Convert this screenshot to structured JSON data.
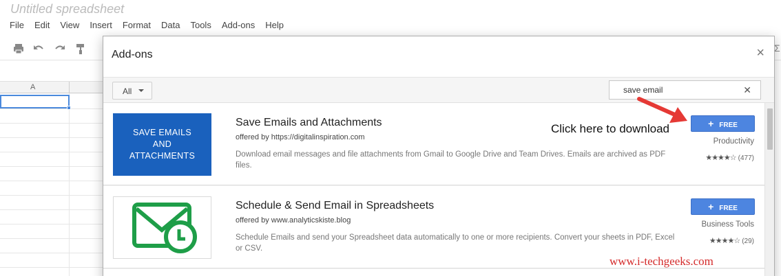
{
  "document": {
    "title": "Untitled spreadsheet"
  },
  "menu": [
    "File",
    "Edit",
    "View",
    "Insert",
    "Format",
    "Data",
    "Tools",
    "Add-ons",
    "Help"
  ],
  "sheet": {
    "column_a": "A",
    "right_edge_glyph": "Σ"
  },
  "dialog": {
    "title": "Add-ons",
    "close_glyph": "×",
    "filter": {
      "selected": "All"
    },
    "search": {
      "value": "save email",
      "clear_glyph": "✕"
    }
  },
  "addons": [
    {
      "thumb_text": [
        "SAVE EMAILS",
        "AND",
        "ATTACHMENTS"
      ],
      "name": "Save Emails and Attachments",
      "offered_by": "offered by https://digitalinspiration.com",
      "description": "Download email messages and file attachments from Gmail to Google Drive and Team Drives. Emails are archived as PDF files.",
      "button_label": "FREE",
      "category": "Productivity",
      "stars": "★★★★☆",
      "rating_count": "(477)"
    },
    {
      "name": "Schedule & Send Email in Spreadsheets",
      "offered_by": "offered by www.analyticskiste.blog",
      "description": "Schedule Emails and send your Spreadsheet data automatically to one or more recipients. Convert your sheets in PDF, Excel or CSV.",
      "button_label": "FREE",
      "category": "Business Tools",
      "stars": "★★★★☆",
      "rating_count": "(29)"
    }
  ],
  "annotation": {
    "text": "Click here to download",
    "arrow_color": "#e53935"
  },
  "watermark": "www.i-techgeeks.com",
  "colors": {
    "accent": "#4d85e0",
    "thumb_blue": "#1a61bd",
    "icon_green": "#1e9e48",
    "watermark": "#d42a2a"
  }
}
